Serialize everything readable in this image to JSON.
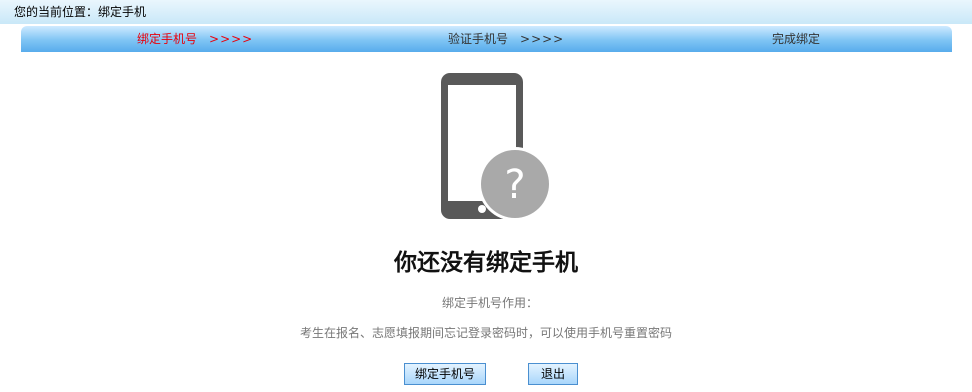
{
  "breadcrumb": {
    "text": "您的当前位置：绑定手机"
  },
  "steps": [
    {
      "label": "绑定手机号",
      "arrows": ">>>>",
      "active": true
    },
    {
      "label": "验证手机号",
      "arrows": ">>>>",
      "active": false
    },
    {
      "label": "完成绑定",
      "arrows": "",
      "active": false
    }
  ],
  "illustration": {
    "icon": "phone-question-icon",
    "symbol": "?",
    "colors": {
      "phone": "#595959",
      "badge": "#a9a9a9",
      "screen": "#ffffff"
    }
  },
  "main": {
    "headline": "你还没有绑定手机",
    "desc_title": "绑定手机号作用：",
    "desc_text": "考生在报名、志愿填报期间忘记登录密码时，可以使用手机号重置密码"
  },
  "actions": {
    "bind_label": "绑定手机号",
    "exit_label": "退出"
  },
  "colors": {
    "active_step": "#e8000b",
    "bar_top": "#cfeaff",
    "bar_bottom": "#58acec"
  }
}
